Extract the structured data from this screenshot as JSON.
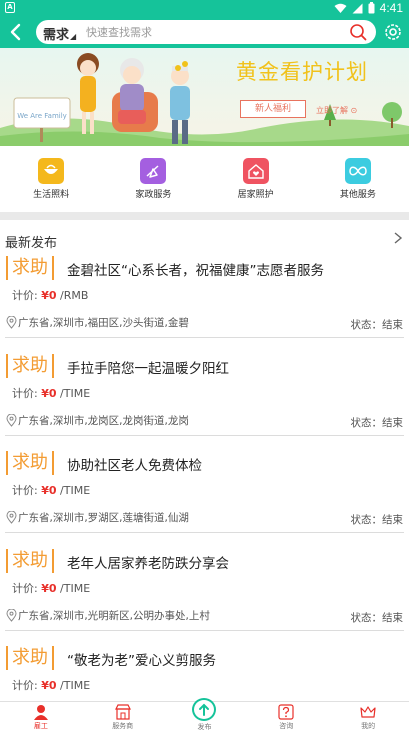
{
  "status_bar": {
    "left_icon_text": "A",
    "time": "4:41",
    "color": "#15c39a"
  },
  "header": {
    "search_category": "需求",
    "search_placeholder": "快速查找需求"
  },
  "banner": {
    "title": "黄金看护计划",
    "welfare_button": "新人福利",
    "learn_more": "立即了解 ⊙",
    "sign_text": "We Are Family"
  },
  "categories": [
    {
      "label": "生活照料",
      "icon": "life-care-icon",
      "color": "#f4b81c"
    },
    {
      "label": "家政服务",
      "icon": "housekeeping-icon",
      "color": "#a45fe0"
    },
    {
      "label": "居家照护",
      "icon": "home-care-icon",
      "color": "#ef5361"
    },
    {
      "label": "其他服务",
      "icon": "other-services-icon",
      "color": "#3ccce0"
    }
  ],
  "section": {
    "title": "最新发布"
  },
  "items": [
    {
      "tag": "求助",
      "title": "金碧社区“心系长者，祝福健康”志愿者服务",
      "price_label": "计价:",
      "price": "¥0",
      "unit": "/RMB",
      "location": "广东省,深圳市,福田区,沙头街道,金碧",
      "status": "状态：结束"
    },
    {
      "tag": "求助",
      "title": "手拉手陪您一起温暖夕阳红",
      "price_label": "计价:",
      "price": "¥0",
      "unit": "/TIME",
      "location": "广东省,深圳市,龙岗区,龙岗街道,龙岗",
      "status": "状态：结束"
    },
    {
      "tag": "求助",
      "title": "协助社区老人免费体检",
      "price_label": "计价:",
      "price": "¥0",
      "unit": "/TIME",
      "location": "广东省,深圳市,罗湖区,莲塘街道,仙湖",
      "status": "状态：结束"
    },
    {
      "tag": "求助",
      "title": "老年人居家养老防跌分享会",
      "price_label": "计价:",
      "price": "¥0",
      "unit": "/TIME",
      "location": "广东省,深圳市,光明新区,公明办事处,上村",
      "status": "状态：结束"
    },
    {
      "tag": "求助",
      "title": "“敬老为老”爱心义剪服务",
      "price_label": "计价:",
      "price": "¥0",
      "unit": "/TIME",
      "location": "",
      "status": ""
    }
  ],
  "bottom_nav": [
    {
      "label": "雇工",
      "icon": "worker-icon",
      "active": true
    },
    {
      "label": "服务商",
      "icon": "shop-icon",
      "active": false
    },
    {
      "label": "发布",
      "icon": "publish-icon",
      "active": false
    },
    {
      "label": "咨询",
      "icon": "question-icon",
      "active": false
    },
    {
      "label": "我的",
      "icon": "crown-icon",
      "active": false
    }
  ],
  "colors": {
    "brand": "#15c39a",
    "tag": "#f39c33",
    "price": "#e8302a"
  }
}
